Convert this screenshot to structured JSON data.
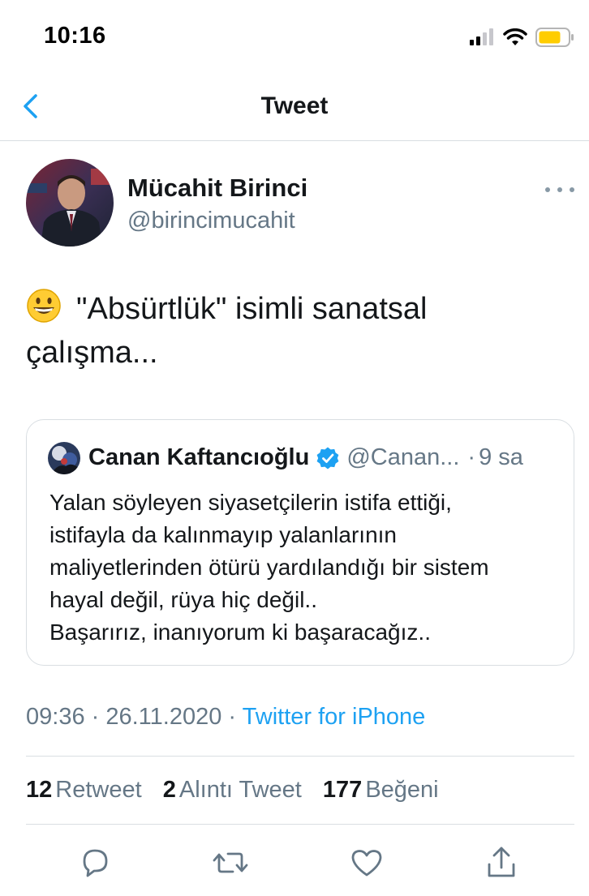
{
  "status_bar": {
    "time": "10:16",
    "icons": [
      "signal-icon",
      "wifi-icon",
      "battery-icon"
    ]
  },
  "nav": {
    "title": "Tweet",
    "back_icon": "chevron-left-icon"
  },
  "tweet": {
    "author_name": "Mücahit Birinci",
    "author_handle": "@birincimucahit",
    "emoji": "grinning-face-emoji",
    "text": "\"Absürtlük\" isimli sanatsal çalışma...",
    "quote": {
      "author_name": "Canan Kaftancıoğlu",
      "verified": true,
      "author_handle": "@Canan...",
      "separator": "·",
      "time": "9 sa",
      "text": "Yalan söyleyen siyasetçilerin istifa ettiği,\nistifayla da kalınmayıp yalanlarının\nmaliyetlerinden ötürü yardılandığı bir sistem\nhayal değil, rüya hiç değil..\nBaşarırız, inanıyorum ki başaracağız.."
    },
    "time": "09:36",
    "date": "26.11.2020",
    "separator": "·",
    "source": "Twitter for iPhone"
  },
  "stats": {
    "retweets_count": "12",
    "retweets_label": "Retweet",
    "quotes_count": "2",
    "quotes_label": "Alıntı Tweet",
    "likes_count": "177",
    "likes_label": "Beğeni"
  },
  "actions": [
    "reply-icon",
    "retweet-icon",
    "like-icon",
    "share-icon"
  ],
  "colors": {
    "accent": "#1da1f2",
    "secondary_text": "#657786",
    "border": "#d9dee2",
    "battery": "#ffcd00"
  }
}
